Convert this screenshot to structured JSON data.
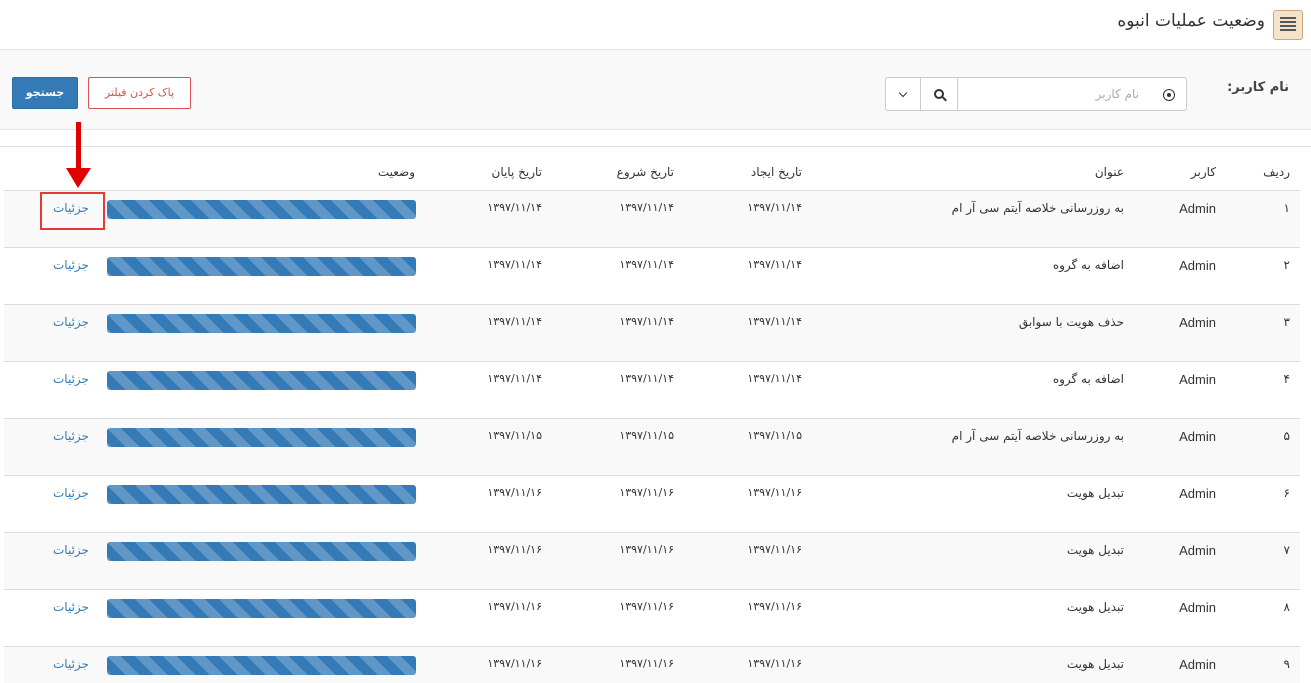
{
  "header": {
    "title": "وضعیت عملیات انبوه",
    "icon": "list-document-icon"
  },
  "filter": {
    "user_label": "نام کاربر:",
    "user_input_placeholder": "نام کاربر",
    "user_input_value": "",
    "clear_label": "پاک کردن فیلتر",
    "search_label": "جستجو",
    "search_icon": "search-icon",
    "dropdown_icon": "chevron-down-icon",
    "radio_icon": "radio-target-icon"
  },
  "table": {
    "headers": {
      "index": "ردیف",
      "user": "کاربر",
      "title": "عنوان",
      "created": "تاریخ ایجاد",
      "start": "تاریخ شروع",
      "end": "تاریخ پایان",
      "status": "وضعیت"
    },
    "details_label": "جزئیات",
    "rows": [
      {
        "index": "۱",
        "user": "Admin",
        "title": "به روزرسانی خلاصه آیتم سی آر ام",
        "created": "۱۳۹۷/۱۱/۱۴",
        "start": "۱۳۹۷/۱۱/۱۴",
        "end": "۱۳۹۷/۱۱/۱۴",
        "progress": 1.0
      },
      {
        "index": "۲",
        "user": "Admin",
        "title": "اضافه به گروه",
        "created": "۱۳۹۷/۱۱/۱۴",
        "start": "۱۳۹۷/۱۱/۱۴",
        "end": "۱۳۹۷/۱۱/۱۴",
        "progress": 1.0
      },
      {
        "index": "۳",
        "user": "Admin",
        "title": "حذف هویت با سوابق",
        "created": "۱۳۹۷/۱۱/۱۴",
        "start": "۱۳۹۷/۱۱/۱۴",
        "end": "۱۳۹۷/۱۱/۱۴",
        "progress": 1.0
      },
      {
        "index": "۴",
        "user": "Admin",
        "title": "اضافه به گروه",
        "created": "۱۳۹۷/۱۱/۱۴",
        "start": "۱۳۹۷/۱۱/۱۴",
        "end": "۱۳۹۷/۱۱/۱۴",
        "progress": 1.0
      },
      {
        "index": "۵",
        "user": "Admin",
        "title": "به روزرسانی خلاصه آیتم سی آر ام",
        "created": "۱۳۹۷/۱۱/۱۵",
        "start": "۱۳۹۷/۱۱/۱۵",
        "end": "۱۳۹۷/۱۱/۱۵",
        "progress": 1.0
      },
      {
        "index": "۶",
        "user": "Admin",
        "title": "تبدیل هویت",
        "created": "۱۳۹۷/۱۱/۱۶",
        "start": "۱۳۹۷/۱۱/۱۶",
        "end": "۱۳۹۷/۱۱/۱۶",
        "progress": 1.0
      },
      {
        "index": "۷",
        "user": "Admin",
        "title": "تبدیل هویت",
        "created": "۱۳۹۷/۱۱/۱۶",
        "start": "۱۳۹۷/۱۱/۱۶",
        "end": "۱۳۹۷/۱۱/۱۶",
        "progress": 1.0
      },
      {
        "index": "۸",
        "user": "Admin",
        "title": "تبدیل هویت",
        "created": "۱۳۹۷/۱۱/۱۶",
        "start": "۱۳۹۷/۱۱/۱۶",
        "end": "۱۳۹۷/۱۱/۱۶",
        "progress": 1.0
      },
      {
        "index": "۹",
        "user": "Admin",
        "title": "تبدیل هویت",
        "created": "۱۳۹۷/۱۱/۱۶",
        "start": "۱۳۹۷/۱۱/۱۶",
        "end": "۱۳۹۷/۱۱/۱۶",
        "progress": 1.0
      }
    ]
  },
  "colors": {
    "accent": "#337ab7",
    "danger": "#d9534f",
    "annotation": "#e00000"
  }
}
